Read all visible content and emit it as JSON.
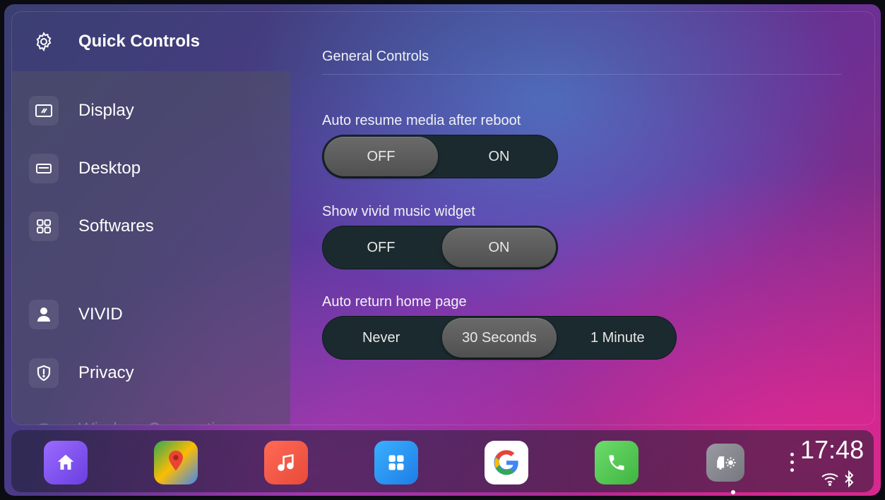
{
  "sidebar": {
    "header": {
      "label": "Quick Controls",
      "icon": "gear-icon"
    },
    "items": [
      {
        "label": "Display",
        "icon": "display-icon"
      },
      {
        "label": "Desktop",
        "icon": "desktop-icon"
      },
      {
        "label": "Softwares",
        "icon": "grid-icon"
      },
      {
        "label": "VIVID",
        "icon": "person-icon"
      },
      {
        "label": "Privacy",
        "icon": "shield-icon"
      },
      {
        "label": "Wireless Connection",
        "icon": "wifi-icon"
      }
    ]
  },
  "main": {
    "section_title": "General Controls",
    "settings": [
      {
        "label": "Auto resume media after reboot",
        "options": [
          "OFF",
          "ON"
        ],
        "selected": "OFF"
      },
      {
        "label": "Show vivid music widget",
        "options": [
          "OFF",
          "ON"
        ],
        "selected": "ON"
      },
      {
        "label": "Auto return home page",
        "options": [
          "Never",
          "30 Seconds",
          "1 Minute"
        ],
        "selected": "30 Seconds"
      }
    ]
  },
  "dock": {
    "apps": [
      {
        "name": "home-app-icon",
        "color": "#8b5cf6"
      },
      {
        "name": "google-maps-app-icon",
        "color": "#4caf50"
      },
      {
        "name": "music-app-icon",
        "color": "#f05a4a"
      },
      {
        "name": "apps-grid-app-icon",
        "color": "#2196f3"
      },
      {
        "name": "google-app-icon",
        "color": "#ffffff"
      },
      {
        "name": "phone-app-icon",
        "color": "#4caf50"
      },
      {
        "name": "car-settings-app-icon",
        "color": "#8a8a90"
      }
    ],
    "time": "17:48",
    "status_icons": [
      "wifi-icon",
      "bluetooth-icon"
    ]
  }
}
